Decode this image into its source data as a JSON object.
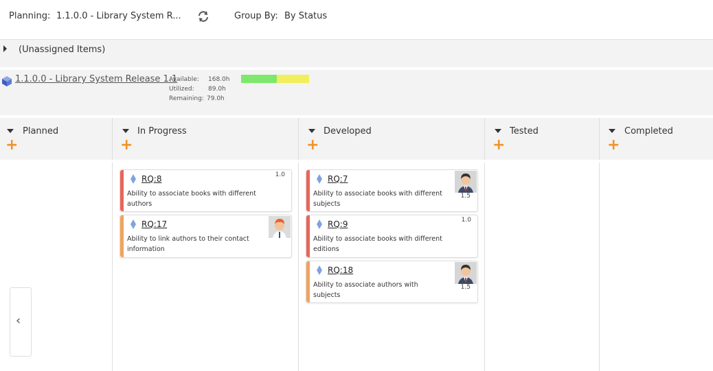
{
  "toolbar": {
    "planning_label": "Planning:",
    "planning_value": "1.1.0.0 - Library System R...",
    "refresh_icon": "refresh-icon",
    "groupby_label": "Group By:",
    "groupby_value": "By Status"
  },
  "unassigned": {
    "label": "(Unassigned Items)"
  },
  "release": {
    "title": "1.1.0.0 - Library System Release 1.1",
    "available_label": "Available:",
    "available_value": "168.0h",
    "utilized_label": "Utilized:",
    "utilized_value": "89.0h",
    "remaining_label": "Remaining:",
    "remaining_value": "79.0h",
    "utilized_fraction": 0.53,
    "colors": {
      "utilized": "#7ee86c",
      "remaining": "#f2ef5c"
    }
  },
  "columns": [
    {
      "name": "Planned"
    },
    {
      "name": "In Progress"
    },
    {
      "name": "Developed"
    },
    {
      "name": "Tested"
    },
    {
      "name": "Completed"
    }
  ],
  "cards": {
    "rq8": {
      "id": "RQ:8",
      "desc1": "Ability to associate books with different",
      "desc2": "authors",
      "estimate": "1.0",
      "stripe": "#e8655a"
    },
    "rq17": {
      "id": "RQ:17",
      "desc1": "Ability to link authors to their contact",
      "desc2": "information",
      "estimate": "",
      "stripe": "#f0a45d"
    },
    "rq7": {
      "id": "RQ:7",
      "desc1": "Ability to associate books with different",
      "desc2": "subjects",
      "estimate": "1.5",
      "stripe": "#e8655a"
    },
    "rq9": {
      "id": "RQ:9",
      "desc1": "Ability to associate books with different",
      "desc2": "editions",
      "estimate": "1.0",
      "stripe": "#e8655a"
    },
    "rq18": {
      "id": "RQ:18",
      "desc1": "Ability to associate authors with",
      "desc2": "subjects",
      "estimate": "1.5",
      "stripe": "#f0a45d"
    }
  },
  "icons": {
    "collapse": "chevron-left-icon",
    "add": "plus-icon",
    "requirement": "diamond-icon",
    "release": "cube-icon"
  }
}
